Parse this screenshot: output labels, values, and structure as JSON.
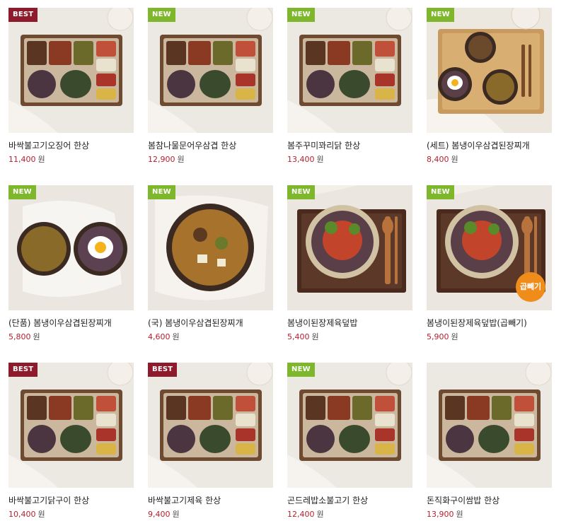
{
  "currency": "원",
  "products": [
    {
      "name": "바싹불고기오징어 한상",
      "price": "11,400",
      "badge": "BEST",
      "style": "bento"
    },
    {
      "name": "봄참나물문어우삼겹 한상",
      "price": "12,900",
      "badge": "NEW",
      "style": "bento"
    },
    {
      "name": "봄주꾸미꽈리닭 한상",
      "price": "13,400",
      "badge": "NEW",
      "style": "bento"
    },
    {
      "name": "(세트) 봄냉이우삼겹된장찌개",
      "price": "8,400",
      "badge": "NEW",
      "style": "set-tray"
    },
    {
      "name": "(단품) 봄냉이우삼겹된장찌개",
      "price": "5,800",
      "badge": "NEW",
      "style": "two-bowls"
    },
    {
      "name": "(국) 봄냉이우삼겹된장찌개",
      "price": "4,600",
      "badge": "NEW",
      "style": "stew-pot"
    },
    {
      "name": "봄냉이된장제육덮밥",
      "price": "5,400",
      "badge": "NEW",
      "style": "rice-bowl"
    },
    {
      "name": "봄냉이된장제육덮밥(곱빼기)",
      "price": "5,900",
      "badge": "NEW",
      "style": "rice-bowl",
      "sticker": "곱빼기"
    },
    {
      "name": "바싹불고기닭구이 한상",
      "price": "10,400",
      "badge": "BEST",
      "style": "bento"
    },
    {
      "name": "바싹불고기제육 한상",
      "price": "9,400",
      "badge": "BEST",
      "style": "bento"
    },
    {
      "name": "곤드레밥소불고기 한상",
      "price": "12,400",
      "badge": "NEW",
      "style": "bento"
    },
    {
      "name": "돈직화구이쌈밥 한상",
      "price": "13,900",
      "badge": "",
      "style": "bento"
    }
  ],
  "colors": {
    "best_badge": "#8e1b2c",
    "new_badge": "#7eb72c",
    "price": "#b5202f",
    "sticker": "#f08c1a"
  }
}
